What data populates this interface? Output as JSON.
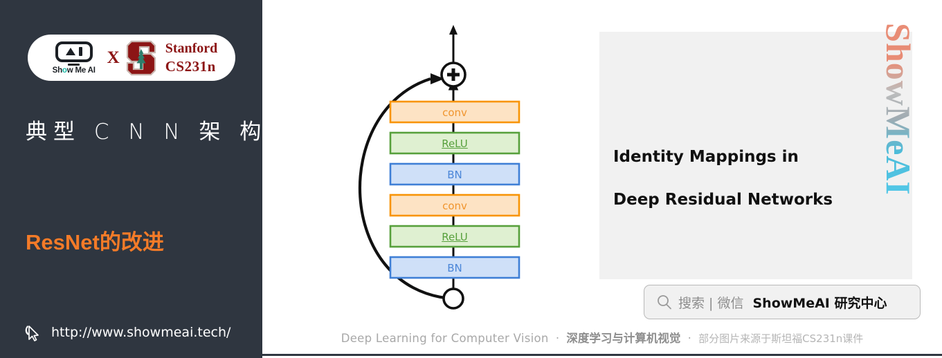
{
  "left_panel": {
    "logo": {
      "showmeai_wordmark": "Show Me AI",
      "cross_symbol": "X",
      "stanford_line1": "Stanford",
      "stanford_line2": "CS231n",
      "showmeai_icon": "robot-screen-icon",
      "stanford_icon": "stanford-tree-s-icon"
    },
    "title": "典型 C N N 架 构",
    "subtitle": "ResNet的改进",
    "url": "http://www.showmeai.tech/",
    "cursor_icon": "mouse-cursor-icon",
    "background_color": "#2f3640",
    "accent_color": "#f47b28"
  },
  "diagram": {
    "name": "resnet-preactivation-residual-block",
    "add_node_symbol": "+",
    "layers": [
      {
        "label": "conv",
        "type": "conv",
        "border": "#f89406",
        "fill": "#fde3c4",
        "text": "#f0952e"
      },
      {
        "label": "ReLU",
        "type": "relu",
        "border": "#57a03c",
        "fill": "#dff0d1",
        "text": "#57a03c"
      },
      {
        "label": "BN",
        "type": "bn",
        "border": "#3f7fd6",
        "fill": "#cfe0f8",
        "text": "#4b86d8"
      },
      {
        "label": "conv",
        "type": "conv",
        "border": "#f89406",
        "fill": "#fde3c4",
        "text": "#f0952e"
      },
      {
        "label": "ReLU",
        "type": "relu",
        "border": "#57a03c",
        "fill": "#dff0d1",
        "text": "#57a03c"
      },
      {
        "label": "BN",
        "type": "bn",
        "border": "#3f7fd6",
        "fill": "#cfe0f8",
        "text": "#4b86d8"
      }
    ],
    "skip_connection": "identity-shortcut-curve",
    "input_node": "open-circle-branch-node",
    "output_arrow": "output-arrow-up"
  },
  "paper_panel": {
    "title_line1": "Identity Mappings in",
    "title_line2": "Deep Residual Networks",
    "background_color": "#f1f1f1"
  },
  "watermark": {
    "text": "ShowMeAI"
  },
  "search_box": {
    "icon": "magnifier-icon",
    "label": "搜索 | 微信",
    "brand": "ShowMeAI 研究中心"
  },
  "footer": {
    "english": "Deep Learning for Computer Vision",
    "separator": "·",
    "chinese_bold": "深度学习与计算机视觉",
    "chinese_small": "部分图片来源于斯坦福CS231n课件"
  }
}
